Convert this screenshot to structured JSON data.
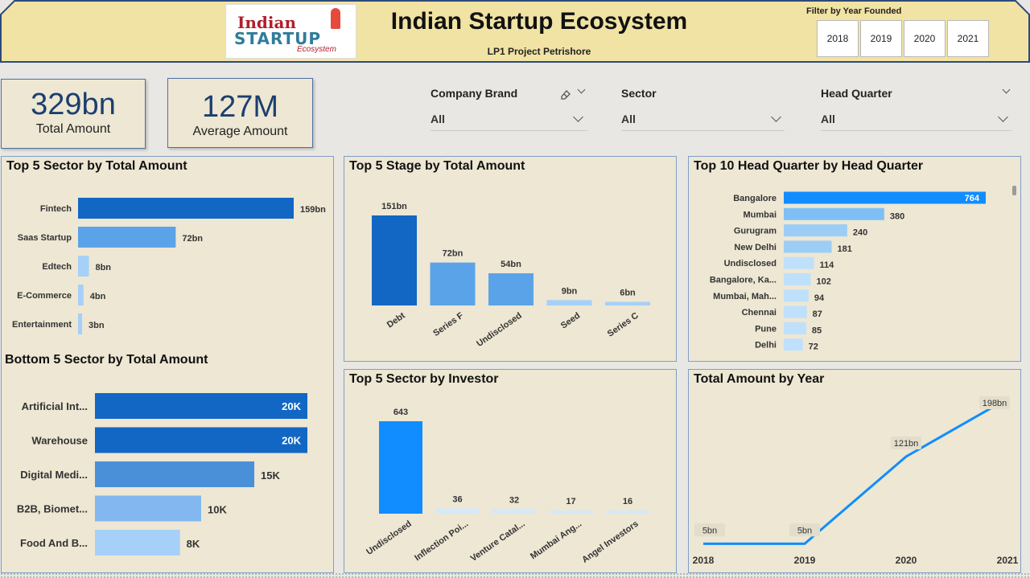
{
  "header": {
    "logo_line1": "Indian",
    "logo_line2": "STARTUP",
    "logo_line3": "Ecosystem",
    "title": "Indian Startup Ecosystem",
    "subtitle": "LP1 Project Petrishore",
    "filter_label": "Filter by Year Founded",
    "year_buttons": [
      "2018",
      "2019",
      "2020",
      "2021"
    ],
    "header_bg": "#f1e3a4",
    "header_border": "#2e4a7a"
  },
  "kpis": {
    "total_amount": {
      "value": "329bn",
      "label": "Total Amount"
    },
    "average_amount": {
      "value": "127M",
      "label": "Average Amount"
    }
  },
  "slicers": {
    "company_brand": {
      "label": "Company Brand",
      "value": "All"
    },
    "sector": {
      "label": "Sector",
      "value": "All"
    },
    "head_quarter": {
      "label": "Head Quarter",
      "value": "All"
    }
  },
  "panels": {
    "top5_sector_amount_title": "Top 5 Sector by Total Amount",
    "bottom5_sector_amount_title": "Bottom 5 Sector by Total Amount",
    "top5_stage_title": "Top 5 Stage by Total Amount",
    "top10_hq_title": "Top 10 Head Quarter by Head Quarter",
    "top5_sector_investor_title": "Top 5 Sector by Investor",
    "total_by_year_title": "Total Amount by Year"
  },
  "colors": {
    "dark_blue": "#1267c5",
    "mid_blue": "#5ba3e8",
    "light_blue": "#a6d0f7",
    "bright_blue": "#118dff",
    "panel_bg": "#ede7d3"
  },
  "chart_data": [
    {
      "id": "top5_sector",
      "type": "bar",
      "orientation": "horizontal",
      "title": "Top 5 Sector by Total Amount",
      "categories": [
        "Fintech",
        "Saas Startup",
        "Edtech",
        "E-Commerce",
        "Entertainment"
      ],
      "values": [
        159,
        72,
        8,
        4,
        3
      ],
      "labels": [
        "159bn",
        "72bn",
        "8bn",
        "4bn",
        "3bn"
      ]
    },
    {
      "id": "bottom5_sector",
      "type": "bar",
      "orientation": "horizontal",
      "title": "Bottom 5 Sector by Total Amount",
      "categories": [
        "Artificial Int...",
        "Warehouse",
        "Digital Medi...",
        "B2B, Biomet...",
        "Food And B..."
      ],
      "values": [
        20,
        20,
        15,
        10,
        8
      ],
      "labels": [
        "20K",
        "20K",
        "15K",
        "10K",
        "8K"
      ]
    },
    {
      "id": "top5_stage",
      "type": "bar",
      "orientation": "vertical",
      "title": "Top 5 Stage by Total Amount",
      "categories": [
        "Debt",
        "Series F",
        "Undisclosed",
        "Seed",
        "Series C"
      ],
      "values": [
        151,
        72,
        54,
        9,
        6
      ],
      "labels": [
        "151bn",
        "72bn",
        "54bn",
        "9bn",
        "6bn"
      ]
    },
    {
      "id": "top10_hq",
      "type": "bar",
      "orientation": "horizontal",
      "title": "Top 10 Head Quarter by Head Quarter",
      "categories": [
        "Bangalore",
        "Mumbai",
        "Gurugram",
        "New Delhi",
        "Undisclosed",
        "Bangalore, Ka...",
        "Mumbai, Mah...",
        "Chennai",
        "Pune",
        "Delhi"
      ],
      "values": [
        764,
        380,
        240,
        181,
        114,
        102,
        94,
        87,
        85,
        72
      ],
      "labels": [
        "764",
        "380",
        "240",
        "181",
        "114",
        "102",
        "94",
        "87",
        "85",
        "72"
      ]
    },
    {
      "id": "top5_sector_investor",
      "type": "bar",
      "orientation": "vertical",
      "title": "Top 5 Sector by Investor",
      "categories": [
        "Undisclosed",
        "Inflection Poi...",
        "Venture Catal...",
        "Mumbai Ang...",
        "Angel Investors"
      ],
      "values": [
        643,
        36,
        32,
        17,
        16
      ],
      "labels": [
        "643",
        "36",
        "32",
        "17",
        "16"
      ]
    },
    {
      "id": "total_by_year",
      "type": "line",
      "title": "Total Amount by Year",
      "x": [
        "2018",
        "2019",
        "2020",
        "2021"
      ],
      "values": [
        5,
        5,
        121,
        198
      ],
      "labels": [
        "5bn",
        "5bn",
        "121bn",
        "198bn"
      ]
    }
  ]
}
